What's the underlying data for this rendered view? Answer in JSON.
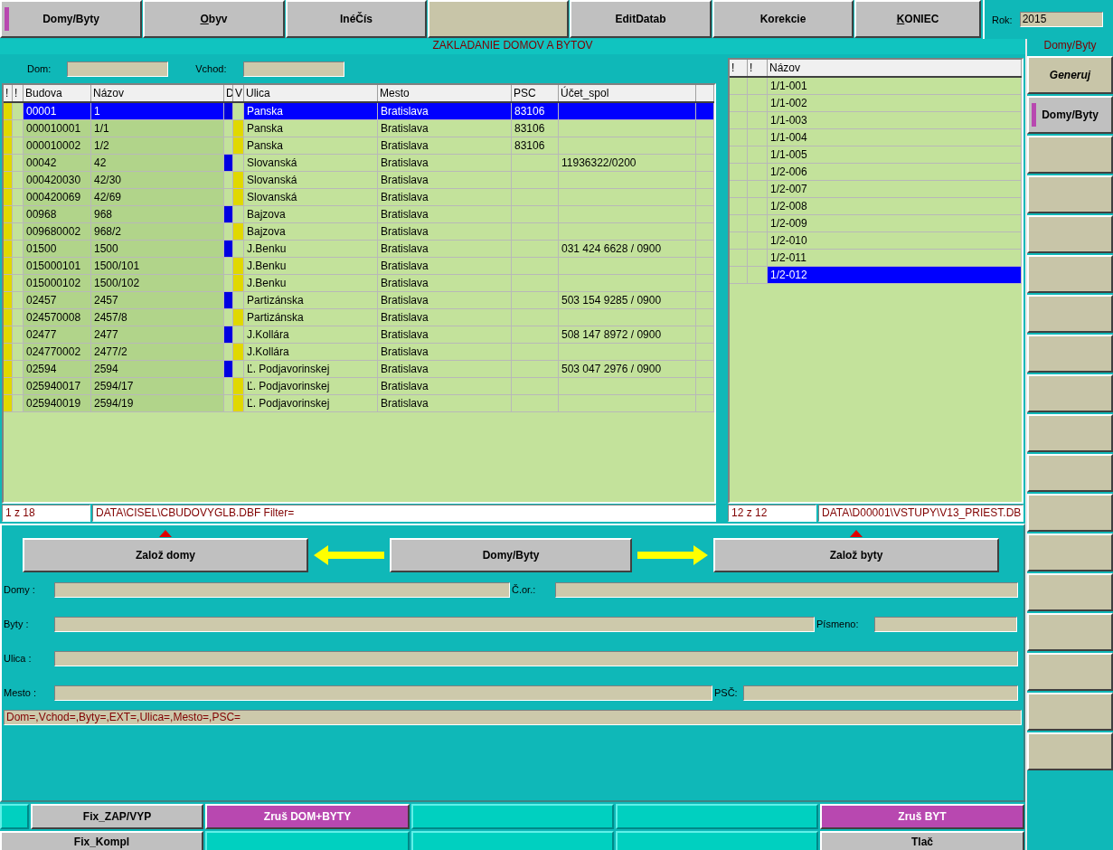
{
  "toolbar": {
    "buttons": [
      {
        "label": "Domy/Byty",
        "active": true,
        "disabled": false
      },
      {
        "accel": "O",
        "label": "byv",
        "active": false,
        "disabled": false
      },
      {
        "label": "InéČís",
        "active": false,
        "disabled": false
      },
      {
        "active": false,
        "disabled": true
      },
      {
        "label": "EditDatab",
        "active": false,
        "disabled": false
      },
      {
        "label": "Korekcie",
        "active": false,
        "disabled": false
      },
      {
        "accel": "K",
        "label": "ONIEC",
        "active": false,
        "disabled": false
      }
    ],
    "year": {
      "label": "Rok:",
      "value": "2015"
    }
  },
  "title": "ZAKLADANIE DOMOV A BYTOV",
  "filters": [
    {
      "label": "Dom:"
    },
    {
      "label": "Vchod:"
    }
  ],
  "buildings": {
    "columns": [
      "!",
      "!",
      "Budova",
      "Názov",
      "D",
      "V",
      "Ulica",
      "Mesto",
      "PSC",
      "Účet_spol"
    ],
    "rows": [
      {
        "budova": "00001",
        "nazov": "1",
        "ulica": "Panska",
        "mesto": "Bratislava",
        "psc": "83106",
        "selected": true,
        "flagged": true,
        "d_mark": true,
        "v_mark": false
      },
      {
        "budova": "000010001",
        "nazov": "1/1",
        "ulica": "Panska",
        "mesto": "Bratislava",
        "psc": "83106",
        "selected": false,
        "flagged": true,
        "d_mark": false,
        "v_mark": true
      },
      {
        "budova": "000010002",
        "nazov": "1/2",
        "ulica": "Panska",
        "mesto": "Bratislava",
        "psc": "83106",
        "selected": false,
        "flagged": true,
        "d_mark": false,
        "v_mark": true
      },
      {
        "budova": "00042",
        "nazov": "42",
        "ulica": "Slovanská",
        "mesto": "Bratislava",
        "ucet": "11936322/0200",
        "selected": false,
        "flagged": true,
        "d_mark": true,
        "v_mark": false
      },
      {
        "budova": "000420030",
        "nazov": "42/30",
        "ulica": "Slovanská",
        "mesto": "Bratislava",
        "selected": false,
        "flagged": true,
        "d_mark": false,
        "v_mark": true
      },
      {
        "budova": "000420069",
        "nazov": "42/69",
        "ulica": "Slovanská",
        "mesto": "Bratislava",
        "selected": false,
        "flagged": true,
        "d_mark": false,
        "v_mark": true
      },
      {
        "budova": "00968",
        "nazov": "968",
        "ulica": "Bajzova",
        "mesto": "Bratislava",
        "selected": false,
        "flagged": true,
        "d_mark": true,
        "v_mark": false
      },
      {
        "budova": "009680002",
        "nazov": "968/2",
        "ulica": "Bajzova",
        "mesto": "Bratislava",
        "selected": false,
        "flagged": true,
        "d_mark": false,
        "v_mark": true
      },
      {
        "budova": "01500",
        "nazov": "1500",
        "ulica": "J.Benku",
        "mesto": "Bratislava",
        "ucet": "031 424 6628 / 0900",
        "selected": false,
        "flagged": true,
        "d_mark": true,
        "v_mark": false
      },
      {
        "budova": "015000101",
        "nazov": "1500/101",
        "ulica": "J.Benku",
        "mesto": "Bratislava",
        "selected": false,
        "flagged": true,
        "d_mark": false,
        "v_mark": true
      },
      {
        "budova": "015000102",
        "nazov": "1500/102",
        "ulica": "J.Benku",
        "mesto": "Bratislava",
        "selected": false,
        "flagged": true,
        "d_mark": false,
        "v_mark": true
      },
      {
        "budova": "02457",
        "nazov": "2457",
        "ulica": "Partizánska",
        "mesto": "Bratislava",
        "ucet": "503 154 9285 / 0900",
        "selected": false,
        "flagged": true,
        "d_mark": true,
        "v_mark": false
      },
      {
        "budova": "024570008",
        "nazov": "2457/8",
        "ulica": "Partizánska",
        "mesto": "Bratislava",
        "selected": false,
        "flagged": true,
        "d_mark": false,
        "v_mark": true
      },
      {
        "budova": "02477",
        "nazov": "2477",
        "ulica": "J.Kollára",
        "mesto": "Bratislava",
        "ucet": "508 147 8972 / 0900",
        "selected": false,
        "flagged": true,
        "d_mark": true,
        "v_mark": false
      },
      {
        "budova": "024770002",
        "nazov": "2477/2",
        "ulica": "J.Kollára",
        "mesto": "Bratislava",
        "selected": false,
        "flagged": true,
        "d_mark": false,
        "v_mark": true
      },
      {
        "budova": "02594",
        "nazov": "2594",
        "ulica": "Ľ. Podjavorinskej",
        "mesto": "Bratislava",
        "ucet": "503 047 2976 / 0900",
        "selected": false,
        "flagged": true,
        "d_mark": true,
        "v_mark": false
      },
      {
        "budova": "025940017",
        "nazov": "2594/17",
        "ulica": "Ľ. Podjavorinskej",
        "mesto": "Bratislava",
        "selected": false,
        "flagged": true,
        "d_mark": false,
        "v_mark": true
      },
      {
        "budova": "025940019",
        "nazov": "2594/19",
        "ulica": "Ľ. Podjavorinskej",
        "mesto": "Bratislava",
        "selected": false,
        "flagged": true,
        "d_mark": false,
        "v_mark": true
      }
    ],
    "status": {
      "position": "1 z 18",
      "path": "DATA\\CISEL\\CBUDOVYGLB.DBF Filter="
    }
  },
  "flats": {
    "columns": [
      "!",
      "!",
      "Názov"
    ],
    "rows": [
      {
        "name": "1/1-001",
        "selected": false
      },
      {
        "name": "1/1-002",
        "selected": false
      },
      {
        "name": "1/1-003",
        "selected": false
      },
      {
        "name": "1/1-004",
        "selected": false
      },
      {
        "name": "1/1-005",
        "selected": false
      },
      {
        "name": "1/2-006",
        "selected": false
      },
      {
        "name": "1/2-007",
        "selected": false
      },
      {
        "name": "1/2-008",
        "selected": false
      },
      {
        "name": "1/2-009",
        "selected": false
      },
      {
        "name": "1/2-010",
        "selected": false
      },
      {
        "name": "1/2-011",
        "selected": false
      },
      {
        "name": "1/2-012",
        "selected": true
      }
    ],
    "status": {
      "position": "12 z 12",
      "path": "DATA\\D00001\\VSTUPY\\V13_PRIEST.DB"
    }
  },
  "actions": {
    "left": "Založ domy",
    "center": "Domy/Byty",
    "right": "Založ byty"
  },
  "form": {
    "domy": "Domy  :",
    "cislo": "Č.or.:",
    "byty": "Byty  :",
    "pismeno": "Písmeno:",
    "ulica": "Ulica :",
    "mesto": "Mesto :",
    "psc": "PSČ:",
    "filter": "Dom=,Vchod=,Byty=,EXT=,Ulica=,Mesto=,PSC="
  },
  "bottom": [
    [
      {
        "kind": "empty"
      },
      {
        "kind": "gray",
        "label": "Fix_ZAP/VYP"
      },
      {
        "kind": "purple",
        "label": "Zruš DOM+BYTY"
      },
      {
        "kind": "empty"
      },
      {
        "kind": "empty"
      },
      {
        "kind": "purple",
        "label": "Zruš BYT"
      }
    ],
    [
      {
        "kind": "gray",
        "label": "Fix_Kompl"
      },
      {
        "kind": "empty"
      },
      {
        "kind": "empty"
      },
      {
        "kind": "empty"
      },
      {
        "kind": "gray",
        "label": "Tlač"
      }
    ]
  ],
  "sidebar": {
    "title": "Domy/Byty",
    "buttons": [
      {
        "label": "Generuj",
        "italic": true,
        "active": false
      },
      {
        "label": "Domy/Byty",
        "italic": false,
        "active": true
      },
      {
        "active": false
      },
      {
        "active": false
      },
      {
        "active": false
      },
      {
        "active": false
      },
      {
        "active": false
      },
      {
        "active": false
      },
      {
        "active": false
      },
      {
        "active": false
      },
      {
        "active": false
      },
      {
        "active": false
      },
      {
        "active": false
      },
      {
        "active": false
      },
      {
        "active": false
      },
      {
        "active": false
      },
      {
        "active": false
      },
      {
        "active": false
      }
    ]
  }
}
